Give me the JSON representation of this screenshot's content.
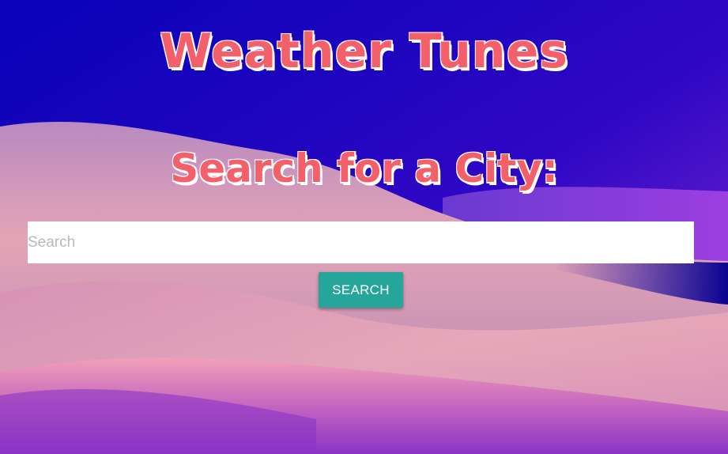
{
  "header": {
    "title": "Weather Tunes",
    "subtitle": "Search for a City:"
  },
  "search": {
    "placeholder": "Search",
    "value": "",
    "button_label": "SEARCH"
  },
  "colors": {
    "heading": "#f4606a",
    "heading_outline": "#ffffff",
    "button": "#26a69a",
    "sky_top": "#0a02b5",
    "dune_pink": "#eaa3b2",
    "bottom_purple": "#8a35c8"
  },
  "background": {
    "icon": "desert-dunes-wallpaper"
  }
}
